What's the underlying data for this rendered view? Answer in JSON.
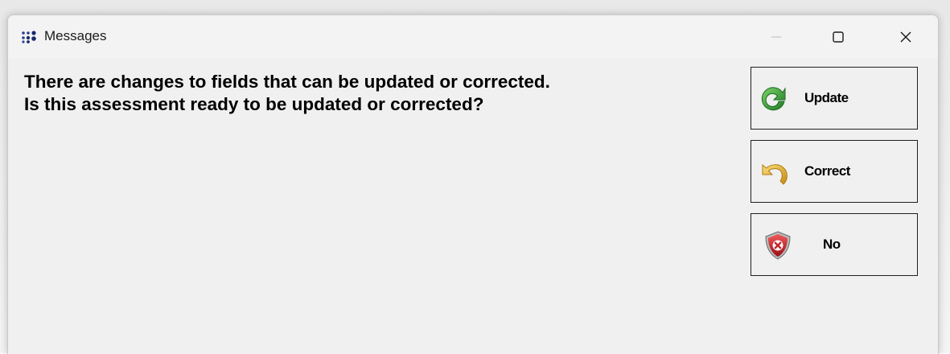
{
  "window": {
    "title": "Messages",
    "icon": "dots-grid-icon",
    "controls": [
      "minimize-icon",
      "maximize-icon",
      "close-icon"
    ]
  },
  "message": {
    "line1": "There are changes to fields that can be updated or corrected.",
    "line2": "Is this assessment ready to be updated or corrected?"
  },
  "buttons": {
    "update": {
      "label": "Update",
      "icon": "refresh-arrow-icon"
    },
    "correct": {
      "label": "Correct",
      "icon": "undo-arrow-icon"
    },
    "no": {
      "label": "No",
      "icon": "shield-x-icon"
    }
  },
  "colors": {
    "window_bg": "#f0f0f0",
    "titlebar_bg": "#f3f3f3",
    "text": "#000000",
    "update_icon": "#2e9e2e",
    "correct_icon": "#e8b23a",
    "no_icon": "#c8202a"
  }
}
